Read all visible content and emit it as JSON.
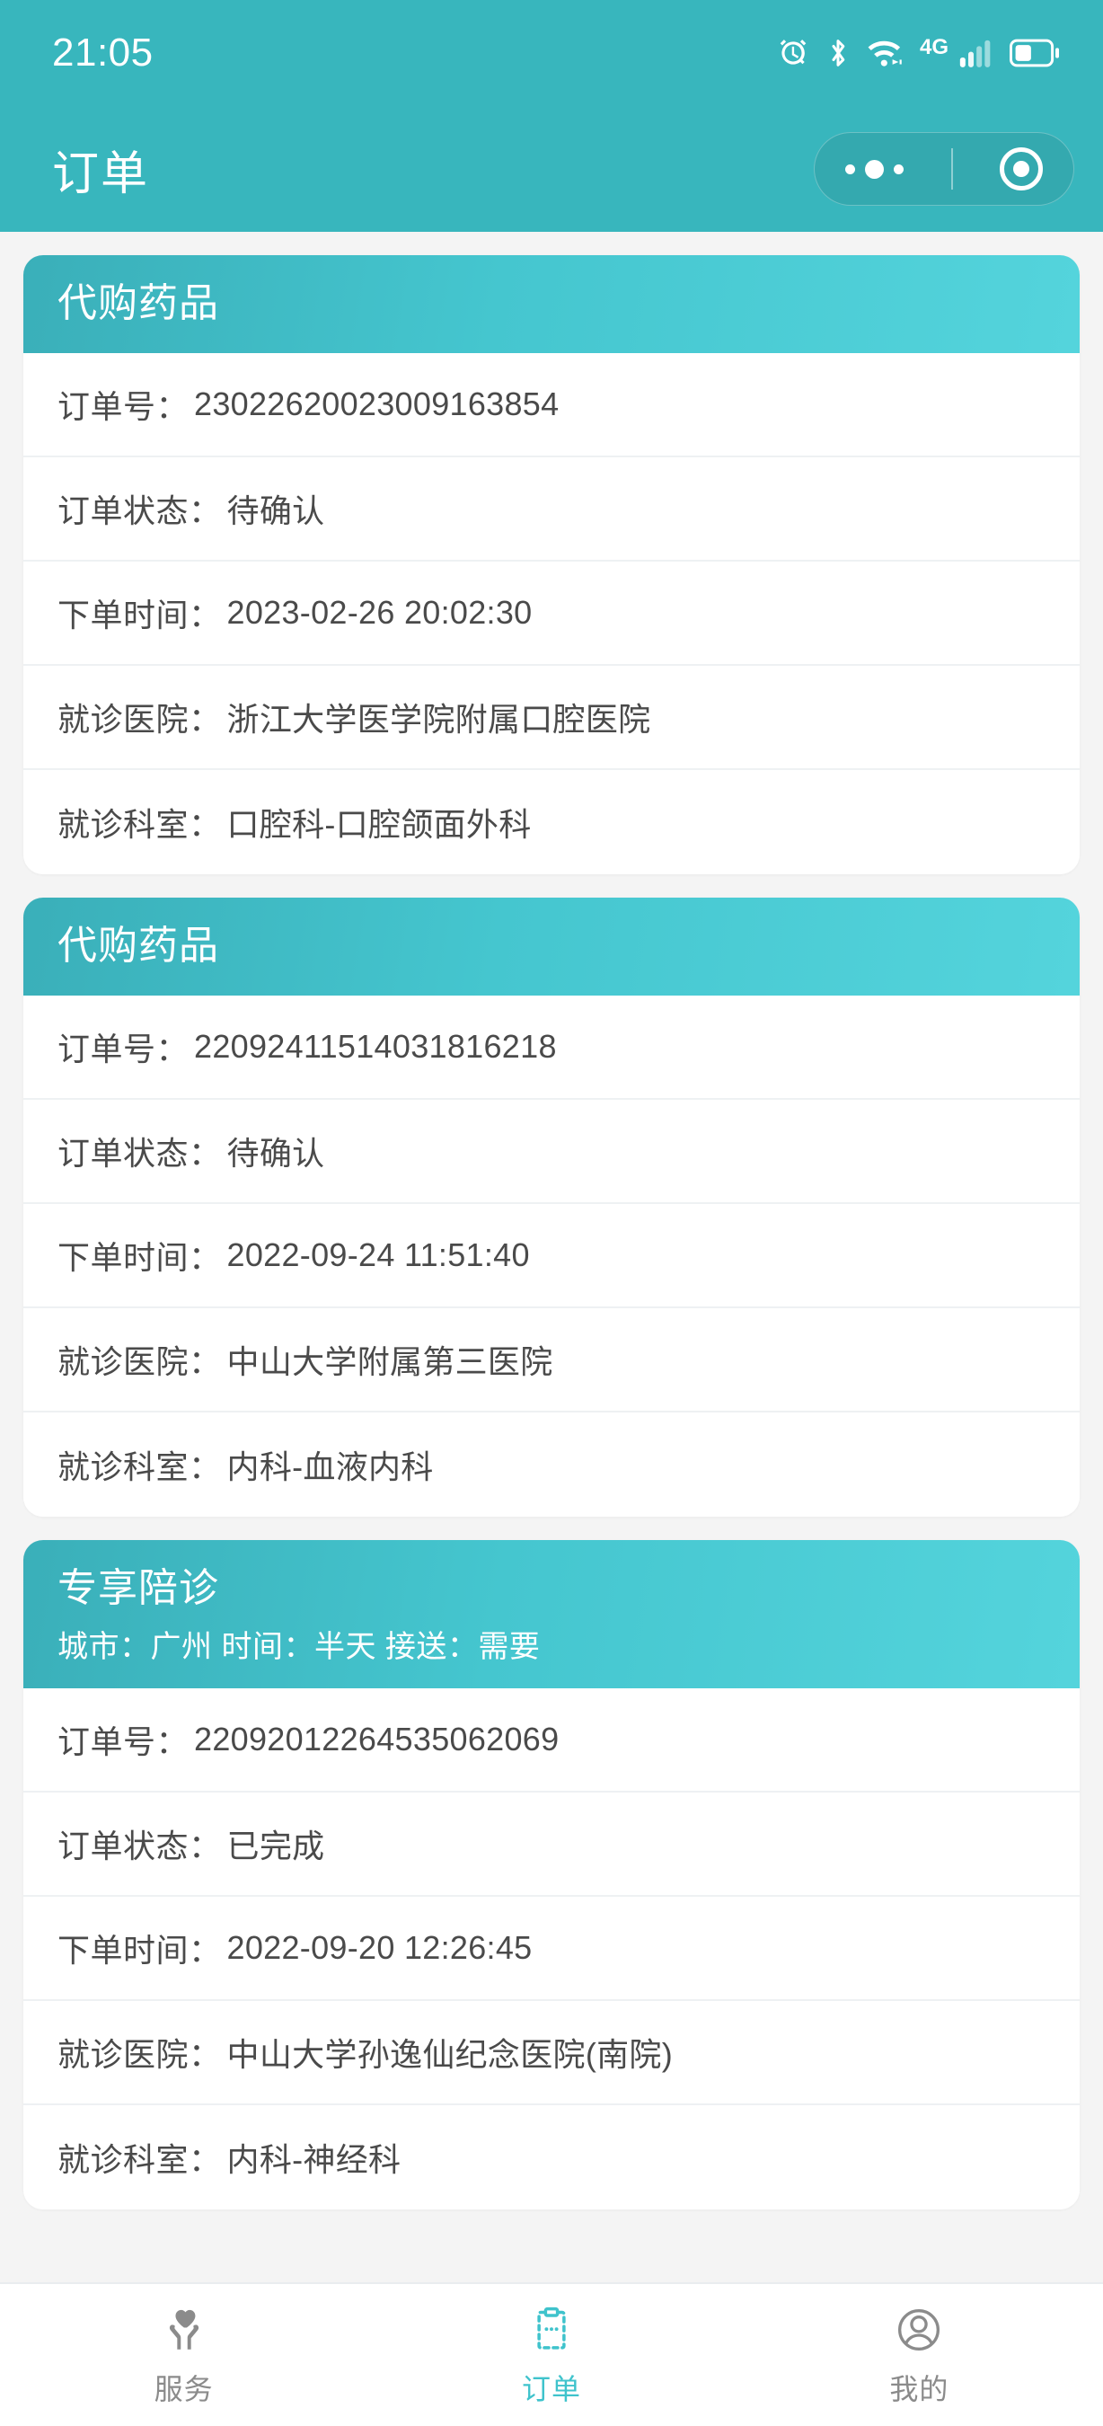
{
  "status_bar": {
    "time": "21:05",
    "network_label": "4G",
    "icons": [
      "alarm-icon",
      "bluetooth-icon",
      "wifi-icon",
      "signal-icon",
      "battery-icon"
    ]
  },
  "nav_bar": {
    "title": "订单",
    "capsule": {
      "menu_icon": "more-dots-icon",
      "target_icon": "target-circle-icon"
    }
  },
  "theme": {
    "primary": "#38b6bd",
    "header_gradient_start": "#3aafb9",
    "header_gradient_end": "#54d4dc",
    "page_background": "#f4f4f4",
    "text": "#4a4a4a",
    "tab_active": "#3fc3cc",
    "tab_inactive": "#8b8b8b"
  },
  "labels": {
    "order_no": "订单号：",
    "order_status": "订单状态：",
    "order_time": "下单时间：",
    "hospital": "就诊医院：",
    "department": "就诊科室："
  },
  "orders": [
    {
      "type": "代购药品",
      "subtitle": "",
      "order_no": "23022620023009163854",
      "status": "待确认",
      "time": "2023-02-26 20:02:30",
      "hospital": "浙江大学医学院附属口腔医院",
      "department": "口腔科-口腔颌面外科"
    },
    {
      "type": "代购药品",
      "subtitle": "",
      "order_no": "22092411514031816218",
      "status": "待确认",
      "time": "2022-09-24 11:51:40",
      "hospital": "中山大学附属第三医院",
      "department": "内科-血液内科"
    },
    {
      "type": "专享陪诊",
      "subtitle": "城市：广州 时间：半天 接送：需要",
      "order_no": "22092012264535062069",
      "status": "已完成",
      "time": "2022-09-20 12:26:45",
      "hospital": "中山大学孙逸仙纪念医院(南院)",
      "department": "内科-神经科"
    }
  ],
  "tab_bar": {
    "items": [
      {
        "label": "服务",
        "icon": "heart-hands-icon",
        "active": false
      },
      {
        "label": "订单",
        "icon": "clipboard-icon",
        "active": true
      },
      {
        "label": "我的",
        "icon": "person-icon",
        "active": false
      }
    ]
  }
}
